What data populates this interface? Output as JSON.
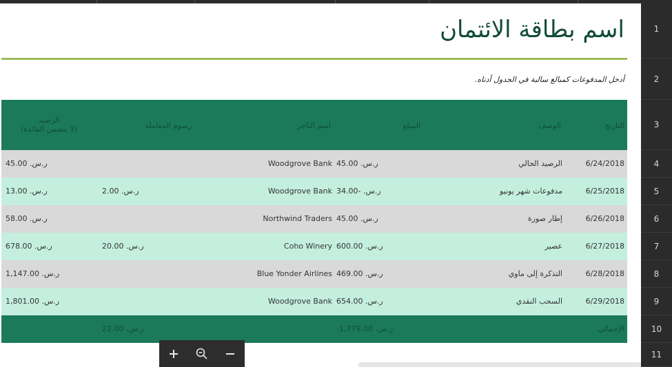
{
  "sheet": {
    "title": "اسم بطاقة الائتمان",
    "instruction": "أدخل المدفوعات كمبالغ سالبة في الجدول أدناه."
  },
  "table": {
    "headers": {
      "date": "التاريخ",
      "description": "الوصف",
      "amount": "المبلغ",
      "merchant": "اسم التاجر",
      "fee": "رسوم المعاملة",
      "balance_line1": "الرصيد",
      "balance_line2": "(لا يتضمن الفائدة)"
    },
    "rows": [
      {
        "date": "6/24/2018",
        "description": "الرصيد الحالي",
        "amount": "ر.س. 45.00",
        "merchant": "Woodgrove Bank",
        "fee": "",
        "balance": "ر.س. 45.00"
      },
      {
        "date": "6/25/2018",
        "description": "مدفوعات شهر يونيو",
        "amount": "ر.س. -34.00",
        "merchant": "Woodgrove Bank",
        "fee": "ر.س. 2.00",
        "balance": "ر.س. 13.00"
      },
      {
        "date": "6/26/2018",
        "description": "إطار صورة",
        "amount": "ر.س. 45.00",
        "merchant": "Northwind Traders",
        "fee": "",
        "balance": "ر.س. 58.00"
      },
      {
        "date": "6/27/2018",
        "description": "عصير",
        "amount": "ر.س. 600.00",
        "merchant": "Coho Winery",
        "fee": "ر.س. 20.00",
        "balance": "ر.س. 678.00"
      },
      {
        "date": "6/28/2018",
        "description": "التذكرة إلى ماوي",
        "amount": "ر.س. 469.00",
        "merchant": "Blue Yonder Airlines",
        "fee": "",
        "balance": "ر.س. 1,147.00"
      },
      {
        "date": "6/29/2018",
        "description": "السحب النقدي",
        "amount": "ر.س. 654.00",
        "merchant": "Woodgrove Bank",
        "fee": "",
        "balance": "ر.س. 1,801.00"
      }
    ],
    "totals": {
      "label": "الإجمالي",
      "amount": "ر.س. 1,779.00",
      "fee": "ر.س. 22.00"
    }
  },
  "row_headers": [
    "1",
    "2",
    "3",
    "4",
    "5",
    "6",
    "7",
    "8",
    "9",
    "10",
    "11"
  ],
  "zoom": {
    "zoom_in_icon": "plus-icon",
    "zoom_reset_icon": "magnifier-minus-icon",
    "zoom_out_icon": "minus-icon"
  },
  "colors": {
    "accent_green": "#1b7a5a",
    "rule_green": "#9bbb59",
    "row_gray": "#d9d9d9",
    "row_mint": "#c4efdf"
  }
}
